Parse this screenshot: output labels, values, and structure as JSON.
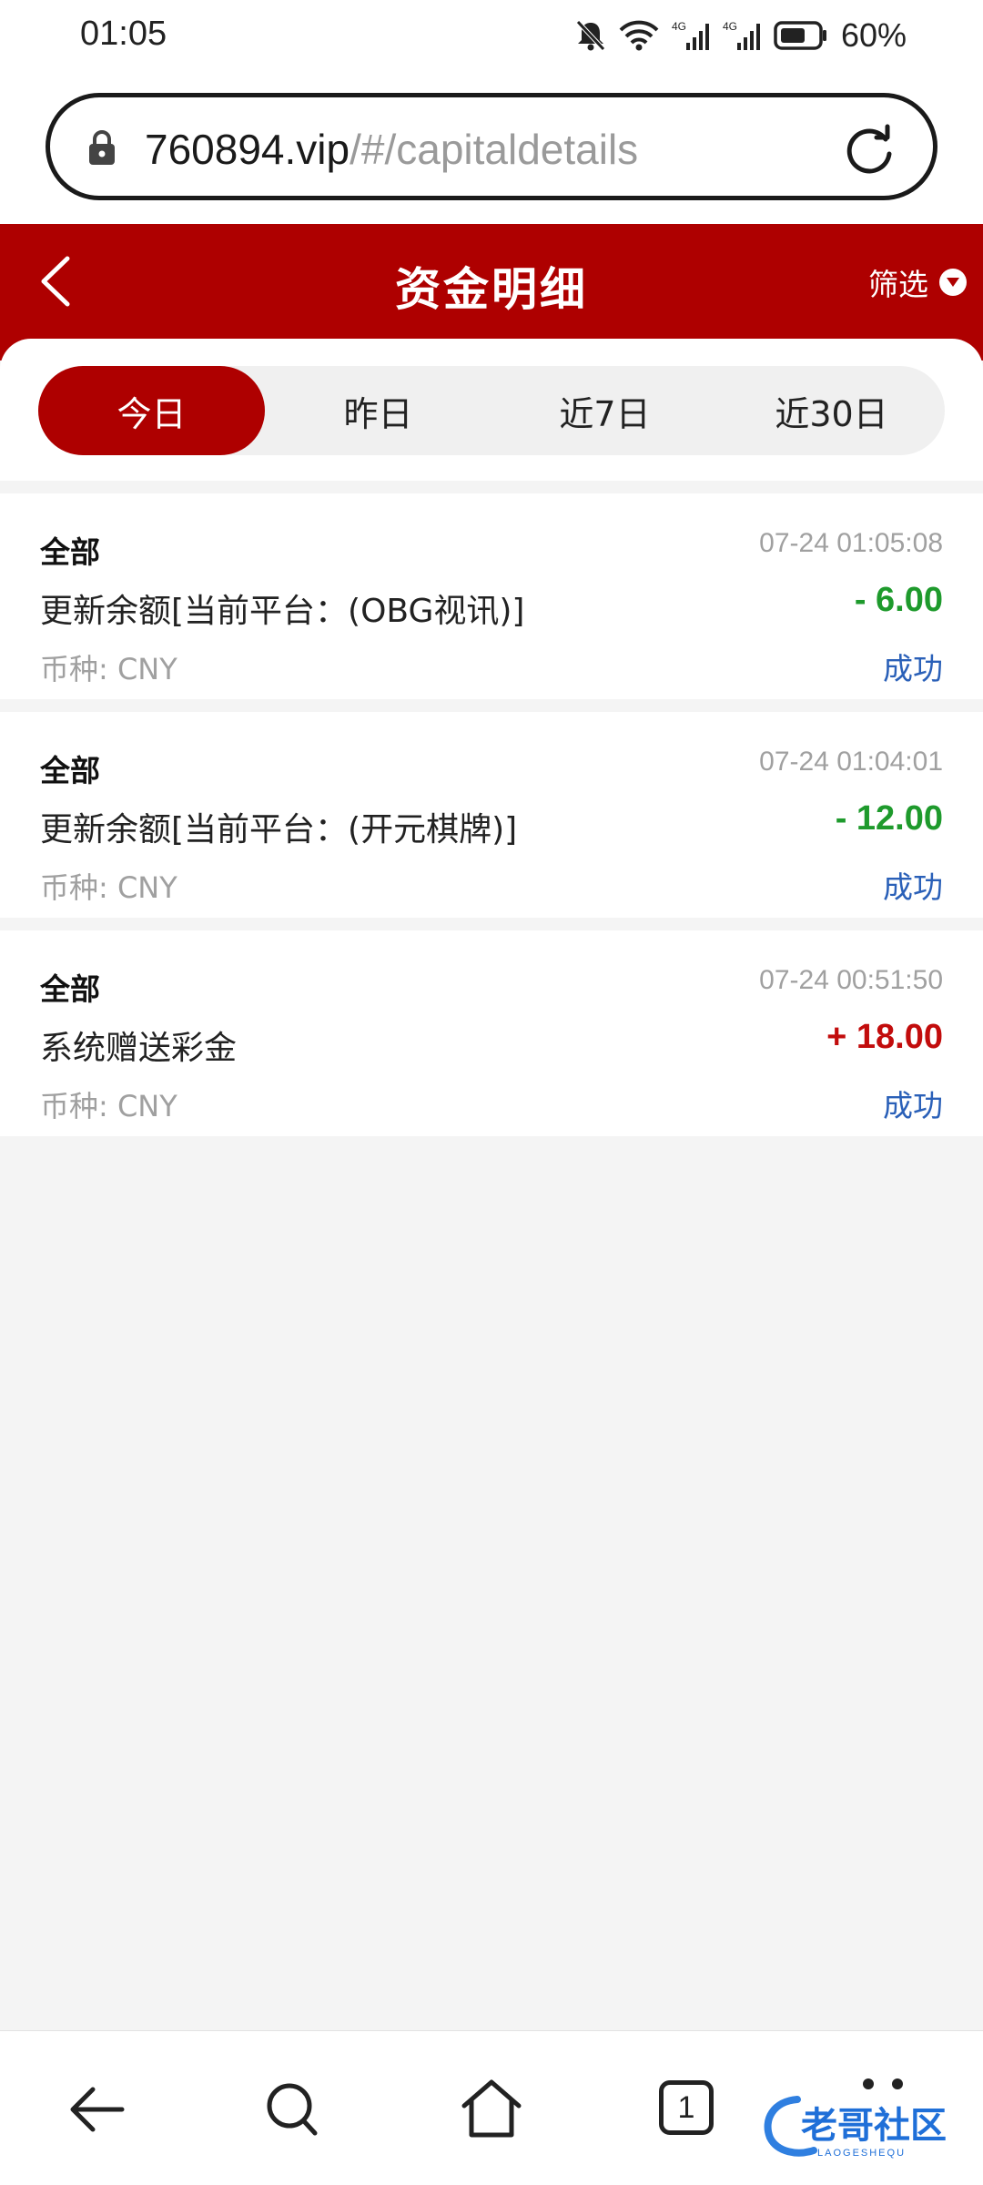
{
  "status_bar": {
    "time": "01:05",
    "battery": "60%",
    "icons": [
      "bell-muted-icon",
      "wifi-icon",
      "signal-4g-icon",
      "signal-4g-icon",
      "battery-icon"
    ]
  },
  "browser": {
    "url_host": "760894.vip",
    "url_path": "/#/capitaldetails"
  },
  "header": {
    "title": "资金明细",
    "filter_label": "筛选"
  },
  "tabs": [
    {
      "label": "今日",
      "active": true
    },
    {
      "label": "昨日",
      "active": false
    },
    {
      "label": "近7日",
      "active": false
    },
    {
      "label": "近30日",
      "active": false
    }
  ],
  "records": [
    {
      "category": "全部",
      "time": "07-24 01:05:08",
      "description": "更新余额[当前平台：(OBG视讯)]",
      "amount": "- 6.00",
      "currency": "币种: CNY",
      "status": "成功"
    },
    {
      "category": "全部",
      "time": "07-24 01:04:01",
      "description": "更新余额[当前平台：(开元棋牌)]",
      "amount": "- 12.00",
      "currency": "币种: CNY",
      "status": "成功"
    },
    {
      "category": "全部",
      "time": "07-24 00:51:50",
      "description": "系统赠送彩金",
      "amount": "+ 18.00",
      "currency": "币种: CNY",
      "status": "成功"
    }
  ],
  "bottom_nav": {
    "tab_count": "1",
    "watermark": "老哥社区",
    "watermark_sub": "LAOGESHEQU"
  },
  "colors": {
    "brand_red": "#ae0000",
    "negative_green": "#1e9a2c",
    "positive_red": "#c20c0c",
    "status_blue": "#2a60b8"
  }
}
